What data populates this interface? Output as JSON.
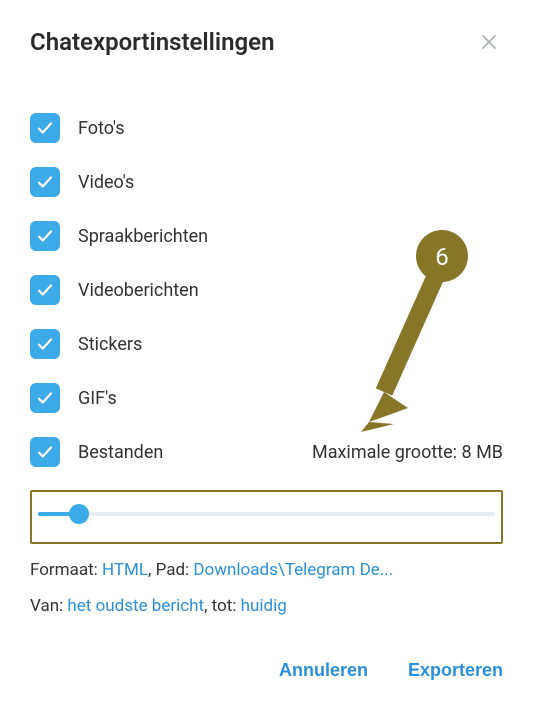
{
  "title": "Chatexportinstellingen",
  "options": [
    {
      "label": "Foto's"
    },
    {
      "label": "Video's"
    },
    {
      "label": "Spraakberichten"
    },
    {
      "label": "Videoberichten"
    },
    {
      "label": "Stickers"
    },
    {
      "label": "GIF's"
    },
    {
      "label": "Bestanden"
    }
  ],
  "maxsize_text": "Maximale grootte: 8 MB",
  "slider_percent": 9,
  "info": {
    "format_prefix": "Formaat: ",
    "format_link": "HTML",
    "path_prefix": ", Pad: ",
    "path_link": "Downloads\\Telegram De...",
    "range_from_prefix": "Van: ",
    "range_from_link": "het oudste bericht",
    "range_to_prefix": ", tot: ",
    "range_to_link": "huidig"
  },
  "buttons": {
    "cancel": "Annuleren",
    "export": "Exporteren"
  },
  "annotation": {
    "badge_number": "6"
  }
}
